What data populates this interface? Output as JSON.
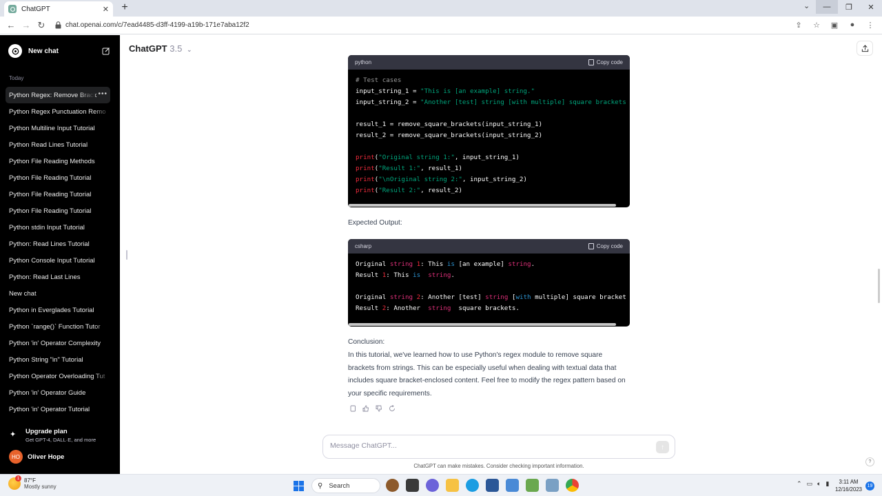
{
  "browser": {
    "tab_title": "ChatGPT",
    "url": "chat.openai.com/c/7ead4485-d3ff-4199-a19b-171e7aba12f2"
  },
  "sidebar": {
    "new_chat": "New chat",
    "section": "Today",
    "items": [
      "Python Regex: Remove Brack",
      "Python Regex Punctuation Remo",
      "Python Multiline Input Tutorial",
      "Python Read Lines Tutorial",
      "Python File Reading Methods",
      "Python File Reading Tutorial",
      "Python File Reading Tutorial",
      "Python File Reading Tutorial",
      "Python stdin Input Tutorial",
      "Python: Read Lines Tutorial",
      "Python Console Input Tutorial",
      "Python: Read Last Lines",
      "New chat",
      "Python in Everglades Tutorial",
      "Python `range()` Function Tutor",
      "Python 'in' Operator Complexity",
      "Python String \"in\" Tutorial",
      "Python Operator Overloading Tut",
      "Python 'in' Operator Guide",
      "Python 'in' Operator Tutorial"
    ],
    "upgrade_title": "Upgrade plan",
    "upgrade_sub": "Get GPT-4, DALL·E, and more",
    "user_initials": "HO",
    "user_name": "Oliver Hope"
  },
  "header": {
    "title": "ChatGPT",
    "version": "3.5"
  },
  "code1": {
    "lang": "python",
    "copy": "Copy code",
    "l1": "# Test cases",
    "l2a": "input_string_1 = ",
    "l2b": "\"This is [an example] string.\"",
    "l3a": "input_string_2 = ",
    "l3b": "\"Another [test] string [with multiple] square brackets",
    "l5": "result_1 = remove_square_brackets(input_string_1)",
    "l6": "result_2 = remove_square_brackets(input_string_2)",
    "l8a": "print",
    "l8b": "(",
    "l8c": "\"Original string 1:\"",
    "l8d": ", input_string_1)",
    "l9c": "\"Result 1:\"",
    "l9d": ", result_1)",
    "l10c": "\"\\nOriginal string 2:\"",
    "l10d": ", input_string_2)",
    "l11c": "\"Result 2:\"",
    "l11d": ", result_2)"
  },
  "expected_label": "Expected Output:",
  "code2": {
    "lang": "csharp",
    "copy": "Copy code",
    "w_original": "Original",
    "w_string": "string",
    "w_result": "Result",
    "w_is": "is",
    "w_with": "with",
    "n1": "1",
    "n2": "2",
    "l1_rest": ": This ",
    "l1_mid": " [an example] ",
    "l1_end": ".",
    "l2_rest": ": This ",
    "l2_end": ".",
    "l4_rest": ": Another [test] ",
    "l4_mid": " [",
    "l4_end": " multiple] square bracket",
    "l5_rest": ": Another  ",
    "l5_end": "  square brackets."
  },
  "conclusion_label": "Conclusion:",
  "conclusion_text": "In this tutorial, we've learned how to use Python's regex module to remove square brackets from strings. This can be especially useful when dealing with textual data that includes square bracket-enclosed content. Feel free to modify the regex pattern based on your specific requirements.",
  "composer": {
    "placeholder": "Message ChatGPT..."
  },
  "disclaimer": "ChatGPT can make mistakes. Consider checking important information.",
  "help": "?",
  "taskbar": {
    "temp": "87°F",
    "weather": "Mostly sunny",
    "weather_badge": "1",
    "search": "Search",
    "time": "3:11 AM",
    "date": "12/16/2023",
    "notifications": "19"
  },
  "colors": {
    "sidebar_bg": "#000000",
    "code_string": "#00a67d",
    "code_function": "#f22c3d",
    "code_keyword": "#2e95d3",
    "code_type": "#df3079"
  }
}
